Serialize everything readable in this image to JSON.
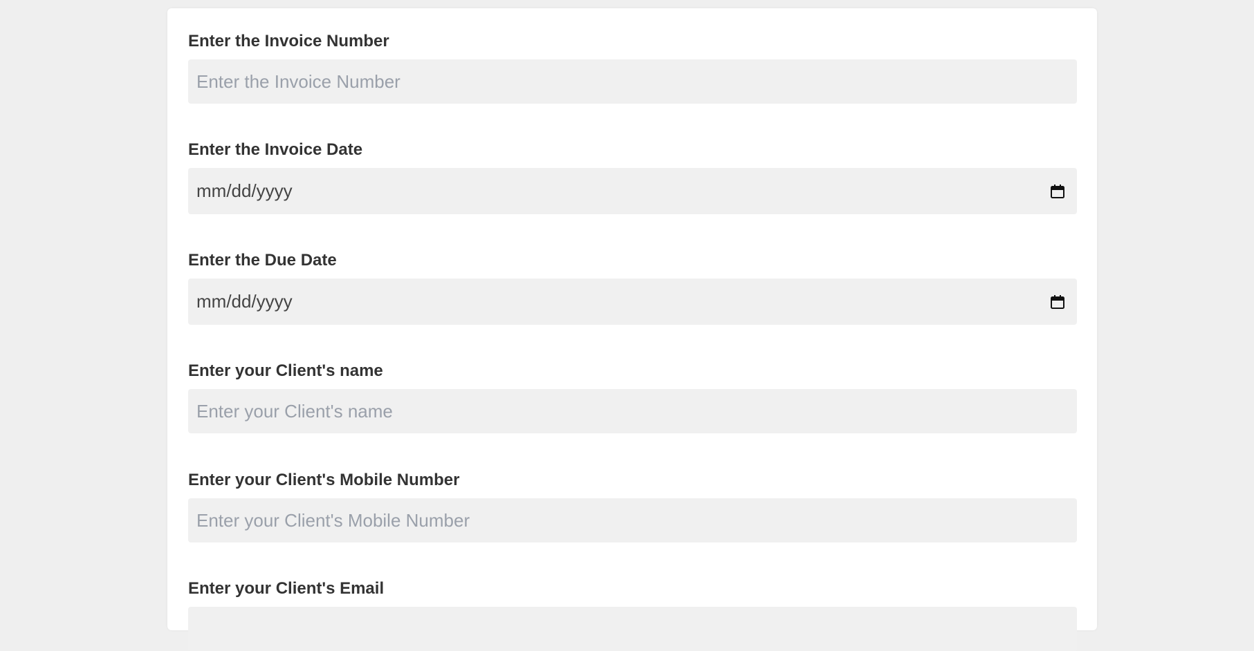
{
  "form": {
    "fields": [
      {
        "label": "Enter the Invoice Number",
        "type": "text",
        "placeholder": "Enter the Invoice Number",
        "value": ""
      },
      {
        "label": "Enter the Invoice Date",
        "type": "date",
        "display": "mm/dd/yyyy",
        "icon": "calendar-icon"
      },
      {
        "label": "Enter the Due Date",
        "type": "date",
        "display": "mm/dd/yyyy",
        "icon": "calendar-icon"
      },
      {
        "label": "Enter your Client's name",
        "type": "text",
        "placeholder": "Enter your Client's name",
        "value": ""
      },
      {
        "label": "Enter your Client's Mobile Number",
        "type": "text",
        "placeholder": "Enter your Client's Mobile Number",
        "value": ""
      },
      {
        "label": "Enter your Client's Email",
        "type": "text",
        "placeholder": "",
        "value": ""
      }
    ]
  },
  "colors": {
    "page_background": "#efefef",
    "card_background": "#ffffff",
    "input_background": "#f0f0f0",
    "label_text": "#333333",
    "placeholder_text": "#9aa0aa"
  }
}
